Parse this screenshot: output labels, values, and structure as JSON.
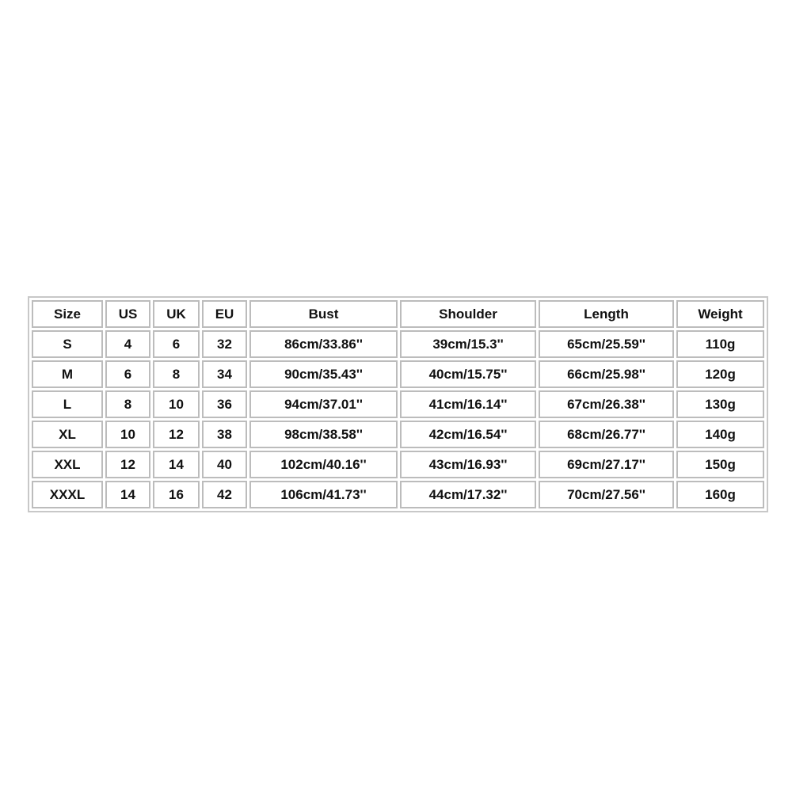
{
  "size_chart": {
    "headers": [
      "Size",
      "US",
      "UK",
      "EU",
      "Bust",
      "Shoulder",
      "Length",
      "Weight"
    ],
    "rows": [
      [
        "S",
        "4",
        "6",
        "32",
        "86cm/33.86''",
        "39cm/15.3''",
        "65cm/25.59''",
        "110g"
      ],
      [
        "M",
        "6",
        "8",
        "34",
        "90cm/35.43''",
        "40cm/15.75''",
        "66cm/25.98''",
        "120g"
      ],
      [
        "L",
        "8",
        "10",
        "36",
        "94cm/37.01''",
        "41cm/16.14''",
        "67cm/26.38''",
        "130g"
      ],
      [
        "XL",
        "10",
        "12",
        "38",
        "98cm/38.58''",
        "42cm/16.54''",
        "68cm/26.77''",
        "140g"
      ],
      [
        "XXL",
        "12",
        "14",
        "40",
        "102cm/40.16''",
        "43cm/16.93''",
        "69cm/27.17''",
        "150g"
      ],
      [
        "XXXL",
        "14",
        "16",
        "42",
        "106cm/41.73''",
        "44cm/17.32''",
        "70cm/27.56''",
        "160g"
      ]
    ]
  }
}
